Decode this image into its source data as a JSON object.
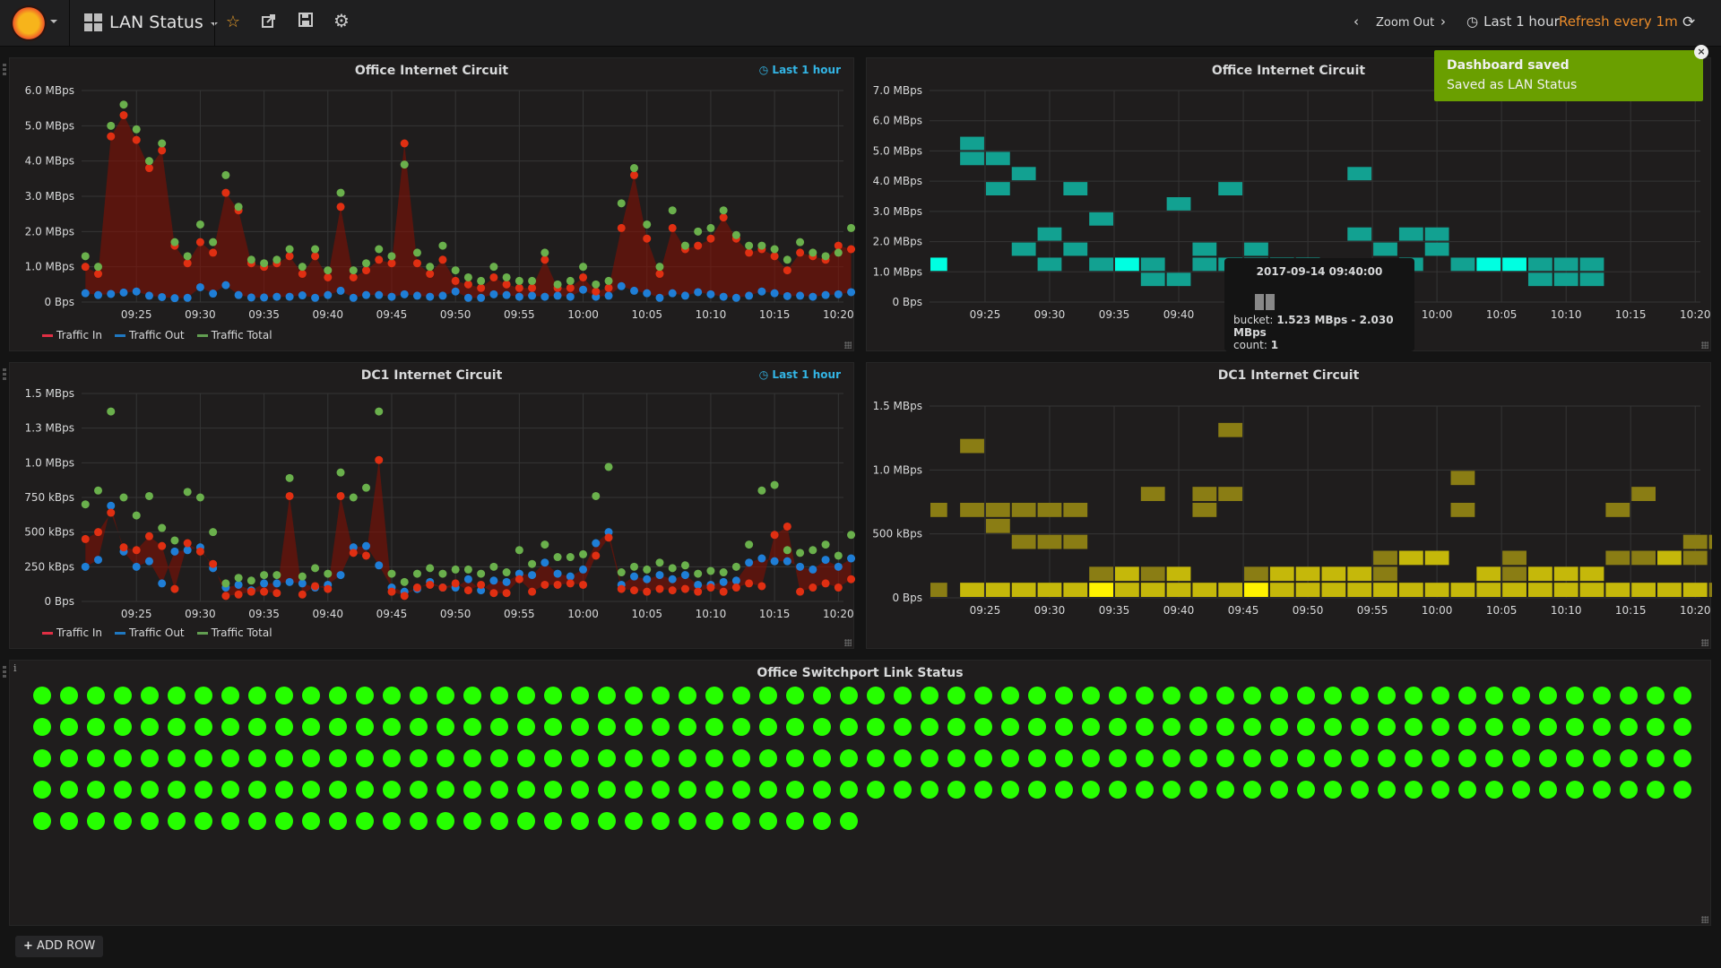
{
  "topnav": {
    "dashboard_title": "LAN Status",
    "icons": [
      "grafana-logo",
      "star-icon",
      "share-icon",
      "save-icon",
      "gear-icon"
    ],
    "zoom_out": "Zoom Out",
    "time_range": "Last 1 hour",
    "refresh": "Refresh every 1m",
    "refresh_color": "#eb8c2a"
  },
  "toast": {
    "title": "Dashboard saved",
    "message": "Saved as LAN Status",
    "color": "#6a9f00"
  },
  "tooltip": {
    "title": "2017-09-14 09:40:00",
    "bucket_label": "bucket:",
    "bucket_value": "1.523 MBps - 2.030 MBps",
    "count_label": "count:",
    "count_value": "1"
  },
  "panels": {
    "p1": {
      "title": "Office Internet Circuit",
      "time_info": "Last 1 hour"
    },
    "p2": {
      "title": "Office Internet Circuit"
    },
    "p3": {
      "title": "DC1 Internet Circuit",
      "time_info": "Last 1 hour"
    },
    "p4": {
      "title": "DC1 Internet Circuit"
    },
    "p5": {
      "title": "Office Switchport Link Status",
      "info": "i"
    }
  },
  "legend": [
    {
      "name": "Traffic In",
      "color": "#e02f44"
    },
    {
      "name": "Traffic Out",
      "color": "#1f78c1"
    },
    {
      "name": "Traffic Total",
      "color": "#629e51"
    }
  ],
  "add_row": "ADD ROW",
  "chart_data": [
    {
      "id": "office-graph",
      "type": "line",
      "title": "Office Internet Circuit",
      "x_start": "09:21",
      "x_step_min": 1,
      "xticks": [
        "09:25",
        "09:30",
        "09:35",
        "09:40",
        "09:45",
        "09:50",
        "09:55",
        "10:00",
        "10:05",
        "10:10",
        "10:15",
        "10:20"
      ],
      "yticks": [
        "0 Bps",
        "1.0 MBps",
        "2.0 MBps",
        "3.0 MBps",
        "4.0 MBps",
        "5.0 MBps",
        "6.0 MBps"
      ],
      "ylim": [
        0,
        6.0
      ],
      "yunit": "MBps",
      "series": [
        {
          "name": "Traffic In",
          "color": "#e02f44",
          "fill": true,
          "values": [
            1.0,
            0.8,
            4.7,
            5.3,
            4.6,
            3.8,
            4.3,
            1.6,
            1.1,
            1.7,
            1.4,
            3.1,
            2.6,
            1.1,
            1.0,
            1.1,
            1.3,
            0.8,
            1.3,
            0.7,
            2.7,
            0.7,
            0.9,
            1.2,
            1.1,
            4.5,
            1.1,
            0.8,
            1.2,
            0.6,
            0.5,
            0.4,
            0.7,
            0.5,
            0.4,
            0.4,
            1.2,
            0.4,
            0.4,
            0.7,
            0.3,
            0.4,
            2.1,
            3.6,
            1.8,
            0.8,
            2.1,
            1.5,
            1.6,
            1.8,
            2.4,
            1.8,
            1.4,
            1.5,
            1.3,
            0.9,
            1.4,
            1.3,
            1.2,
            1.6,
            1.5
          ]
        },
        {
          "name": "Traffic Out",
          "color": "#1f78c1",
          "fill": false,
          "values": [
            0.25,
            0.2,
            0.23,
            0.27,
            0.3,
            0.18,
            0.14,
            0.11,
            0.12,
            0.42,
            0.24,
            0.48,
            0.2,
            0.13,
            0.13,
            0.15,
            0.15,
            0.19,
            0.12,
            0.2,
            0.32,
            0.12,
            0.2,
            0.2,
            0.15,
            0.22,
            0.18,
            0.15,
            0.18,
            0.3,
            0.12,
            0.12,
            0.22,
            0.2,
            0.15,
            0.18,
            0.15,
            0.18,
            0.15,
            0.35,
            0.15,
            0.18,
            0.45,
            0.32,
            0.25,
            0.12,
            0.25,
            0.18,
            0.28,
            0.22,
            0.15,
            0.12,
            0.18,
            0.3,
            0.25,
            0.17,
            0.18,
            0.15,
            0.2,
            0.22,
            0.28
          ]
        },
        {
          "name": "Traffic Total",
          "color": "#629e51",
          "fill": false,
          "values": [
            1.3,
            1.0,
            5.0,
            5.6,
            4.9,
            4.0,
            4.5,
            1.7,
            1.3,
            2.2,
            1.7,
            3.6,
            2.7,
            1.2,
            1.1,
            1.2,
            1.5,
            1.0,
            1.5,
            0.9,
            3.1,
            0.9,
            1.1,
            1.5,
            1.3,
            3.9,
            1.4,
            1.0,
            1.6,
            0.9,
            0.7,
            0.6,
            1.0,
            0.7,
            0.6,
            0.6,
            1.4,
            0.5,
            0.6,
            1.0,
            0.5,
            0.6,
            2.8,
            3.8,
            2.2,
            1.0,
            2.6,
            1.6,
            2.0,
            2.1,
            2.6,
            1.9,
            1.6,
            1.6,
            1.5,
            1.2,
            1.7,
            1.4,
            1.3,
            1.4,
            2.1
          ]
        }
      ]
    },
    {
      "id": "office-heatmap",
      "type": "heatmap",
      "title": "Office Internet Circuit",
      "xticks": [
        "09:25",
        "09:30",
        "09:35",
        "09:40",
        "09:45",
        "09:50",
        "09:55",
        "10:00",
        "10:05",
        "10:10",
        "10:15",
        "10:20"
      ],
      "yticks": [
        "0 Bps",
        "1.0 MBps",
        "2.0 MBps",
        "3.0 MBps",
        "4.0 MBps",
        "5.0 MBps",
        "6.0 MBps",
        "7.0 MBps"
      ],
      "ylim": [
        0,
        7.0
      ],
      "bucket_size_mbps": 0.5,
      "x_start": "09:21",
      "x_step_min": 2,
      "color_low": "#12a191",
      "color_high": "#00ffe1",
      "cells": [
        [
          0,
          2,
          2
        ],
        [
          1,
          10,
          1
        ],
        [
          1,
          9,
          1
        ],
        [
          2,
          9,
          1
        ],
        [
          2,
          7,
          1
        ],
        [
          3,
          8,
          1
        ],
        [
          3,
          3,
          1
        ],
        [
          4,
          4,
          1
        ],
        [
          4,
          2,
          1
        ],
        [
          5,
          7,
          1
        ],
        [
          5,
          3,
          1
        ],
        [
          6,
          5,
          1
        ],
        [
          6,
          2,
          1
        ],
        [
          7,
          2,
          2
        ],
        [
          8,
          2,
          1
        ],
        [
          8,
          1,
          1
        ],
        [
          9,
          1,
          1
        ],
        [
          9,
          6,
          1
        ],
        [
          10,
          3,
          1
        ],
        [
          10,
          2,
          1
        ],
        [
          11,
          7,
          1
        ],
        [
          11,
          2,
          1
        ],
        [
          12,
          3,
          1
        ],
        [
          12,
          2,
          1
        ],
        [
          13,
          2,
          1
        ],
        [
          13,
          1,
          1
        ],
        [
          14,
          2,
          1
        ],
        [
          15,
          1,
          1
        ],
        [
          15,
          0,
          1
        ],
        [
          16,
          8,
          1
        ],
        [
          16,
          4,
          1
        ],
        [
          17,
          3,
          1
        ],
        [
          17,
          1,
          1
        ],
        [
          18,
          4,
          1
        ],
        [
          18,
          2,
          1
        ],
        [
          19,
          3,
          1
        ],
        [
          19,
          4,
          1
        ],
        [
          20,
          2,
          1
        ],
        [
          21,
          2,
          2
        ],
        [
          22,
          2,
          2
        ],
        [
          23,
          2,
          1
        ],
        [
          23,
          1,
          1
        ],
        [
          24,
          2,
          1
        ],
        [
          24,
          1,
          1
        ],
        [
          25,
          2,
          1
        ],
        [
          25,
          1,
          1
        ]
      ]
    },
    {
      "id": "dc1-graph",
      "type": "line",
      "title": "DC1 Internet Circuit",
      "x_start": "09:21",
      "x_step_min": 1,
      "xticks": [
        "09:25",
        "09:30",
        "09:35",
        "09:40",
        "09:45",
        "09:50",
        "09:55",
        "10:00",
        "10:05",
        "10:10",
        "10:15",
        "10:20"
      ],
      "yticks": [
        "0 Bps",
        "250 kBps",
        "500 kBps",
        "750 kBps",
        "1.0 MBps",
        "1.3 MBps",
        "1.5 MBps"
      ],
      "ylim": [
        0,
        1.5
      ],
      "yunit": "MBps",
      "series": [
        {
          "name": "Traffic In",
          "color": "#e02f44",
          "fill": true,
          "values": [
            0.45,
            0.5,
            0.64,
            0.39,
            0.37,
            0.47,
            0.4,
            0.09,
            0.42,
            0.36,
            0.27,
            0.04,
            0.05,
            0.07,
            0.07,
            0.06,
            0.76,
            0.05,
            0.11,
            0.09,
            0.76,
            0.35,
            0.33,
            1.02,
            0.07,
            0.04,
            0.1,
            0.12,
            0.1,
            0.13,
            0.08,
            0.12,
            0.06,
            0.06,
            0.16,
            0.07,
            0.12,
            0.12,
            0.13,
            0.12,
            0.33,
            0.46,
            0.09,
            0.08,
            0.07,
            0.09,
            0.08,
            0.09,
            0.07,
            0.1,
            0.07,
            0.1,
            0.13,
            0.11,
            0.48,
            0.54,
            0.07,
            0.1,
            0.13,
            0.1,
            0.16
          ]
        },
        {
          "name": "Traffic Out",
          "color": "#1f78c1",
          "fill": false,
          "values": [
            0.25,
            0.3,
            0.69,
            0.36,
            0.25,
            0.29,
            0.13,
            0.36,
            0.37,
            0.39,
            0.24,
            0.1,
            0.12,
            0.08,
            0.13,
            0.13,
            0.14,
            0.13,
            0.1,
            0.12,
            0.19,
            0.39,
            0.4,
            0.26,
            0.1,
            0.07,
            0.09,
            0.14,
            0.1,
            0.1,
            0.16,
            0.08,
            0.15,
            0.14,
            0.2,
            0.19,
            0.28,
            0.2,
            0.18,
            0.23,
            0.42,
            0.5,
            0.12,
            0.18,
            0.16,
            0.19,
            0.16,
            0.19,
            0.12,
            0.12,
            0.14,
            0.15,
            0.28,
            0.31,
            0.29,
            0.29,
            0.25,
            0.23,
            0.3,
            0.25,
            0.31
          ]
        },
        {
          "name": "Traffic Total",
          "color": "#629e51",
          "fill": false,
          "values": [
            0.7,
            0.8,
            1.37,
            0.75,
            0.62,
            0.76,
            0.53,
            0.44,
            0.79,
            0.75,
            0.5,
            0.13,
            0.17,
            0.15,
            0.19,
            0.19,
            0.89,
            0.18,
            0.24,
            0.2,
            0.93,
            0.75,
            0.82,
            1.37,
            0.2,
            0.14,
            0.2,
            0.24,
            0.2,
            0.23,
            0.23,
            0.2,
            0.25,
            0.21,
            0.37,
            0.27,
            0.41,
            0.32,
            0.32,
            0.34,
            0.76,
            0.97,
            0.21,
            0.25,
            0.23,
            0.28,
            0.24,
            0.26,
            0.2,
            0.22,
            0.21,
            0.25,
            0.41,
            0.8,
            0.84,
            0.37,
            0.35,
            0.37,
            0.41,
            0.33,
            0.48
          ]
        }
      ]
    },
    {
      "id": "dc1-heatmap",
      "type": "heatmap",
      "title": "DC1 Internet Circuit",
      "xticks": [
        "09:25",
        "09:30",
        "09:35",
        "09:40",
        "09:45",
        "09:50",
        "09:55",
        "10:00",
        "10:05",
        "10:10",
        "10:15",
        "10:20"
      ],
      "yticks": [
        "0 Bps",
        "500 kBps",
        "1.0 MBps",
        "1.5 MBps"
      ],
      "ylim": [
        0,
        1.5
      ],
      "bucket_size_mbps": 0.125,
      "x_start": "09:21",
      "x_step_min": 2,
      "color_low": "#8a7d14",
      "color_high": "#fff200",
      "cells": [
        [
          0,
          0,
          1
        ],
        [
          0,
          5,
          1
        ],
        [
          1,
          0,
          3
        ],
        [
          1,
          5,
          1
        ],
        [
          1,
          9,
          1
        ],
        [
          2,
          0,
          3
        ],
        [
          2,
          5,
          1
        ],
        [
          2,
          4,
          1
        ],
        [
          3,
          0,
          3
        ],
        [
          3,
          5,
          1
        ],
        [
          3,
          3,
          1
        ],
        [
          4,
          0,
          3
        ],
        [
          4,
          5,
          1
        ],
        [
          4,
          3,
          1
        ],
        [
          5,
          0,
          3
        ],
        [
          5,
          5,
          1
        ],
        [
          5,
          3,
          1
        ],
        [
          6,
          0,
          5
        ],
        [
          6,
          1,
          1
        ],
        [
          7,
          0,
          3
        ],
        [
          7,
          1,
          3
        ],
        [
          8,
          0,
          3
        ],
        [
          8,
          1,
          1
        ],
        [
          8,
          6,
          1
        ],
        [
          9,
          0,
          3
        ],
        [
          9,
          1,
          3
        ],
        [
          10,
          0,
          3
        ],
        [
          10,
          5,
          1
        ],
        [
          10,
          6,
          1
        ],
        [
          11,
          0,
          3
        ],
        [
          11,
          6,
          1
        ],
        [
          11,
          10,
          1
        ],
        [
          12,
          0,
          5
        ],
        [
          12,
          1,
          1
        ],
        [
          13,
          0,
          3
        ],
        [
          13,
          1,
          3
        ],
        [
          14,
          0,
          3
        ],
        [
          14,
          1,
          3
        ],
        [
          15,
          0,
          3
        ],
        [
          15,
          1,
          3
        ],
        [
          16,
          0,
          3
        ],
        [
          16,
          1,
          3
        ],
        [
          17,
          0,
          3
        ],
        [
          17,
          1,
          1
        ],
        [
          17,
          2,
          1
        ],
        [
          18,
          0,
          3
        ],
        [
          18,
          2,
          3
        ],
        [
          19,
          0,
          3
        ],
        [
          19,
          2,
          3
        ],
        [
          20,
          0,
          3
        ],
        [
          20,
          5,
          1
        ],
        [
          20,
          7,
          1
        ],
        [
          21,
          0,
          3
        ],
        [
          21,
          1,
          3
        ],
        [
          22,
          0,
          3
        ],
        [
          22,
          1,
          1
        ],
        [
          22,
          2,
          1
        ],
        [
          23,
          0,
          3
        ],
        [
          23,
          1,
          3
        ],
        [
          24,
          0,
          3
        ],
        [
          24,
          1,
          3
        ],
        [
          25,
          0,
          3
        ],
        [
          25,
          1,
          3
        ],
        [
          26,
          0,
          3
        ],
        [
          26,
          2,
          1
        ],
        [
          26,
          5,
          1
        ],
        [
          27,
          0,
          3
        ],
        [
          27,
          2,
          1
        ],
        [
          27,
          6,
          1
        ],
        [
          28,
          0,
          3
        ],
        [
          28,
          2,
          3
        ],
        [
          29,
          0,
          3
        ],
        [
          29,
          2,
          1
        ],
        [
          29,
          3,
          1
        ],
        [
          30,
          0,
          1
        ],
        [
          30,
          3,
          1
        ]
      ]
    }
  ],
  "switchports": {
    "count": 279,
    "status": "up",
    "color": "#26ff00",
    "per_row": 62
  }
}
